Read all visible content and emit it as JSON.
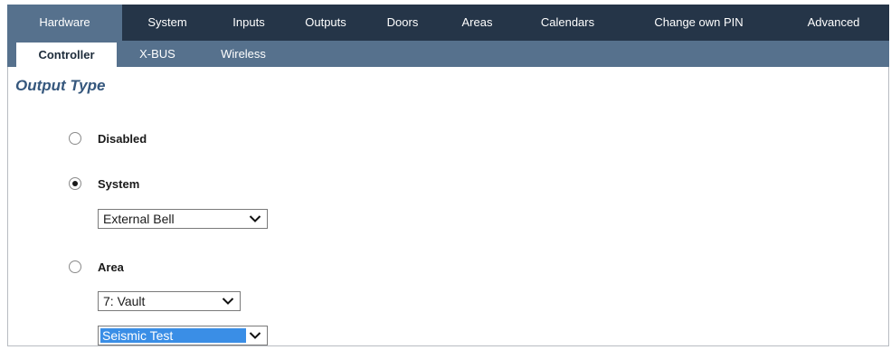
{
  "main_tabs": [
    {
      "label": "Hardware",
      "active": true
    },
    {
      "label": "System",
      "active": false
    },
    {
      "label": "Inputs",
      "active": false
    },
    {
      "label": "Outputs",
      "active": false
    },
    {
      "label": "Doors",
      "active": false
    },
    {
      "label": "Areas",
      "active": false
    },
    {
      "label": "Calendars",
      "active": false
    },
    {
      "label": "Change own PIN",
      "active": false
    },
    {
      "label": "Advanced",
      "active": false
    }
  ],
  "sub_tabs": [
    {
      "label": "Controller",
      "active": true
    },
    {
      "label": "X-BUS",
      "active": false
    },
    {
      "label": "Wireless",
      "active": false
    }
  ],
  "section_title": "Output Type",
  "options": {
    "disabled": {
      "label": "Disabled",
      "selected": false
    },
    "system": {
      "label": "System",
      "selected": true,
      "select_value": "External Bell"
    },
    "area": {
      "label": "Area",
      "selected": false,
      "area_value": "7: Vault",
      "function_value": "Seismic Test"
    }
  },
  "colors": {
    "nav_dark": "#253548",
    "nav_light": "#56718d",
    "title_blue": "#35577d",
    "selection_blue": "#3a8ee6"
  },
  "icons": {
    "dropdown": "chevron-down-icon"
  }
}
